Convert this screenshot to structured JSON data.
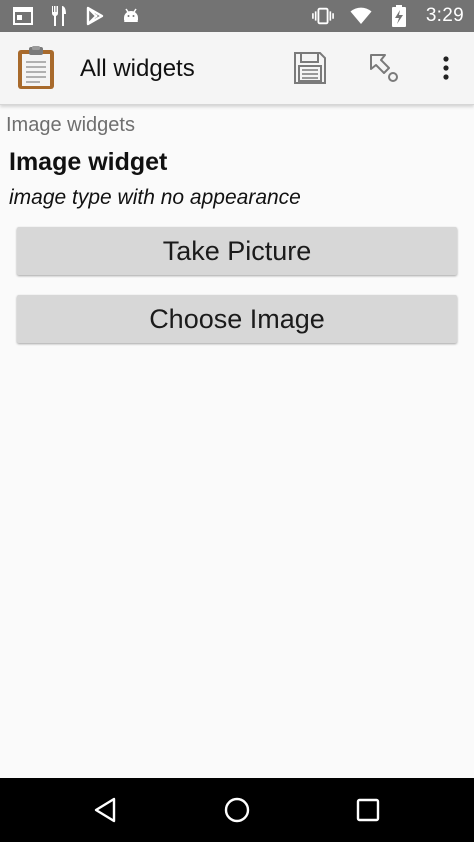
{
  "status_bar": {
    "time": "3:29",
    "icons": [
      "calendar-icon",
      "restaurant-icon",
      "play-store-icon",
      "android-icon",
      "vibrate-icon",
      "wifi-icon",
      "battery-charging-icon"
    ]
  },
  "app_bar": {
    "title": "All widgets",
    "actions": [
      "save-icon",
      "goto-icon",
      "more-vert-icon"
    ]
  },
  "form": {
    "group_label": "Image widgets",
    "question_title": "Image widget",
    "question_hint": "image type with no appearance",
    "take_picture_label": "Take Picture",
    "choose_image_label": "Choose Image"
  },
  "nav_bar": {
    "buttons": [
      "back-icon",
      "home-icon",
      "recents-icon"
    ]
  },
  "colors": {
    "status_bar": "#737373",
    "app_bar": "#f5f5f5",
    "button": "#d7d7d7",
    "background": "#fafafa",
    "nav_bar": "#000000"
  }
}
